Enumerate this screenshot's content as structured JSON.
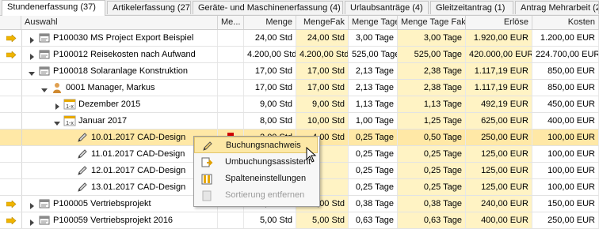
{
  "tabs": [
    {
      "label": "Stundenerfassung (37)"
    },
    {
      "label": "Artikelerfassung (27)"
    },
    {
      "label": "Geräte- und Maschinenerfassung (4)"
    },
    {
      "label": "Urlaubsanträge (4)"
    },
    {
      "label": "Gleitzeitantrag (1)"
    },
    {
      "label": "Antrag Mehrarbeit (2)"
    }
  ],
  "columns": {
    "auswahl": "Auswahl",
    "memo": "Me...",
    "menge": "Menge",
    "mengefak": "MengeFak",
    "menge_tage": "Menge Tage",
    "menge_tage_fak": "Menge Tage Fak",
    "erloese": "Erlöse",
    "kosten": "Kosten"
  },
  "rows": [
    {
      "label": "P100030 MS Project Export Beispiel",
      "menge": "24,00 Std",
      "mengefak": "24,00 Std",
      "tage": "3,00 Tage",
      "tagefak": "3,00 Tage",
      "erloese": "1.920,00 EUR",
      "kosten": "1.200,00 EUR",
      "icon": "project-icon",
      "expander": "collapsed"
    },
    {
      "label": "P100012 Reisekosten nach Aufwand",
      "menge": "4.200,00 Std",
      "mengefak": "4.200,00 Std",
      "tage": "525,00 Tage",
      "tagefak": "525,00 Tage",
      "erloese": "420.000,00 EUR",
      "kosten": "224.700,00 EUR",
      "icon": "project-icon",
      "expander": "collapsed"
    },
    {
      "label": "P100018 Solaranlage Konstruktion",
      "menge": "17,00 Std",
      "mengefak": "17,00 Std",
      "tage": "2,13 Tage",
      "tagefak": "2,38 Tage",
      "erloese": "1.117,19 EUR",
      "kosten": "850,00 EUR",
      "icon": "project-icon",
      "expander": "expanded"
    },
    {
      "label": "0001 Manager, Markus",
      "menge": "17,00 Std",
      "mengefak": "17,00 Std",
      "tage": "2,13 Tage",
      "tagefak": "2,38 Tage",
      "erloese": "1.117,19 EUR",
      "kosten": "850,00 EUR",
      "icon": "person-icon",
      "expander": "expanded"
    },
    {
      "label": "Dezember 2015",
      "menge": "9,00 Std",
      "mengefak": "9,00 Std",
      "tage": "1,13 Tage",
      "tagefak": "1,13 Tage",
      "erloese": "492,19 EUR",
      "kosten": "450,00 EUR",
      "icon": "month-icon",
      "expander": "collapsed"
    },
    {
      "label": "Januar 2017",
      "menge": "8,00 Std",
      "mengefak": "10,00 Std",
      "tage": "1,00 Tage",
      "tagefak": "1,25 Tage",
      "erloese": "625,00 EUR",
      "kosten": "400,00 EUR",
      "icon": "month-icon",
      "expander": "expanded"
    },
    {
      "label": "10.01.2017 CAD-Design",
      "menge": "2,00 Std",
      "mengefak": "4,00 Std",
      "tage": "0,25 Tage",
      "tagefak": "0,50 Tage",
      "erloese": "250,00 EUR",
      "kosten": "100,00 EUR",
      "icon": "pencil-icon",
      "expander": "none",
      "selected": true
    },
    {
      "label": "11.01.2017 CAD-Design",
      "menge": "",
      "mengefak": "",
      "tage": "0,25 Tage",
      "tagefak": "0,25 Tage",
      "erloese": "125,00 EUR",
      "kosten": "100,00 EUR",
      "icon": "pencil-icon",
      "expander": "none"
    },
    {
      "label": "12.01.2017 CAD-Design",
      "menge": "",
      "mengefak": "",
      "tage": "0,25 Tage",
      "tagefak": "0,25 Tage",
      "erloese": "125,00 EUR",
      "kosten": "100,00 EUR",
      "icon": "pencil-icon",
      "expander": "none"
    },
    {
      "label": "13.01.2017 CAD-Design",
      "menge": "",
      "mengefak": "",
      "tage": "0,25 Tage",
      "tagefak": "0,25 Tage",
      "erloese": "125,00 EUR",
      "kosten": "100,00 EUR",
      "icon": "pencil-icon",
      "expander": "none"
    },
    {
      "label": "P100005 Vertriebsprojekt",
      "menge": "3,00 Std",
      "mengefak": "3,00 Std",
      "tage": "0,38 Tage",
      "tagefak": "0,38 Tage",
      "erloese": "240,00 EUR",
      "kosten": "150,00 EUR",
      "icon": "project-icon",
      "expander": "collapsed"
    },
    {
      "label": "P100059 Vertriebsprojekt 2016",
      "menge": "5,00 Std",
      "mengefak": "5,00 Std",
      "tage": "0,63 Tage",
      "tagefak": "0,63 Tage",
      "erloese": "400,00 EUR",
      "kosten": "250,00 EUR",
      "icon": "project-icon",
      "expander": "collapsed"
    }
  ],
  "context_menu": {
    "items": [
      {
        "label": "Buchungsnachweis",
        "icon": "pencil-icon",
        "state": "hover"
      },
      {
        "label": "Umbuchungsassistent",
        "icon": "transfer-icon",
        "state": "normal"
      },
      {
        "label": "Spalteneinstellungen",
        "icon": "columns-icon",
        "state": "normal"
      },
      {
        "label": "Sortierung entfernen",
        "icon": "sort-icon",
        "state": "disabled"
      }
    ]
  },
  "colors": {
    "selected_row": "#ffe8a6",
    "arrow": "#f0b400",
    "memo_marker": "#d00000",
    "menu_hover": "#fce8a6"
  }
}
